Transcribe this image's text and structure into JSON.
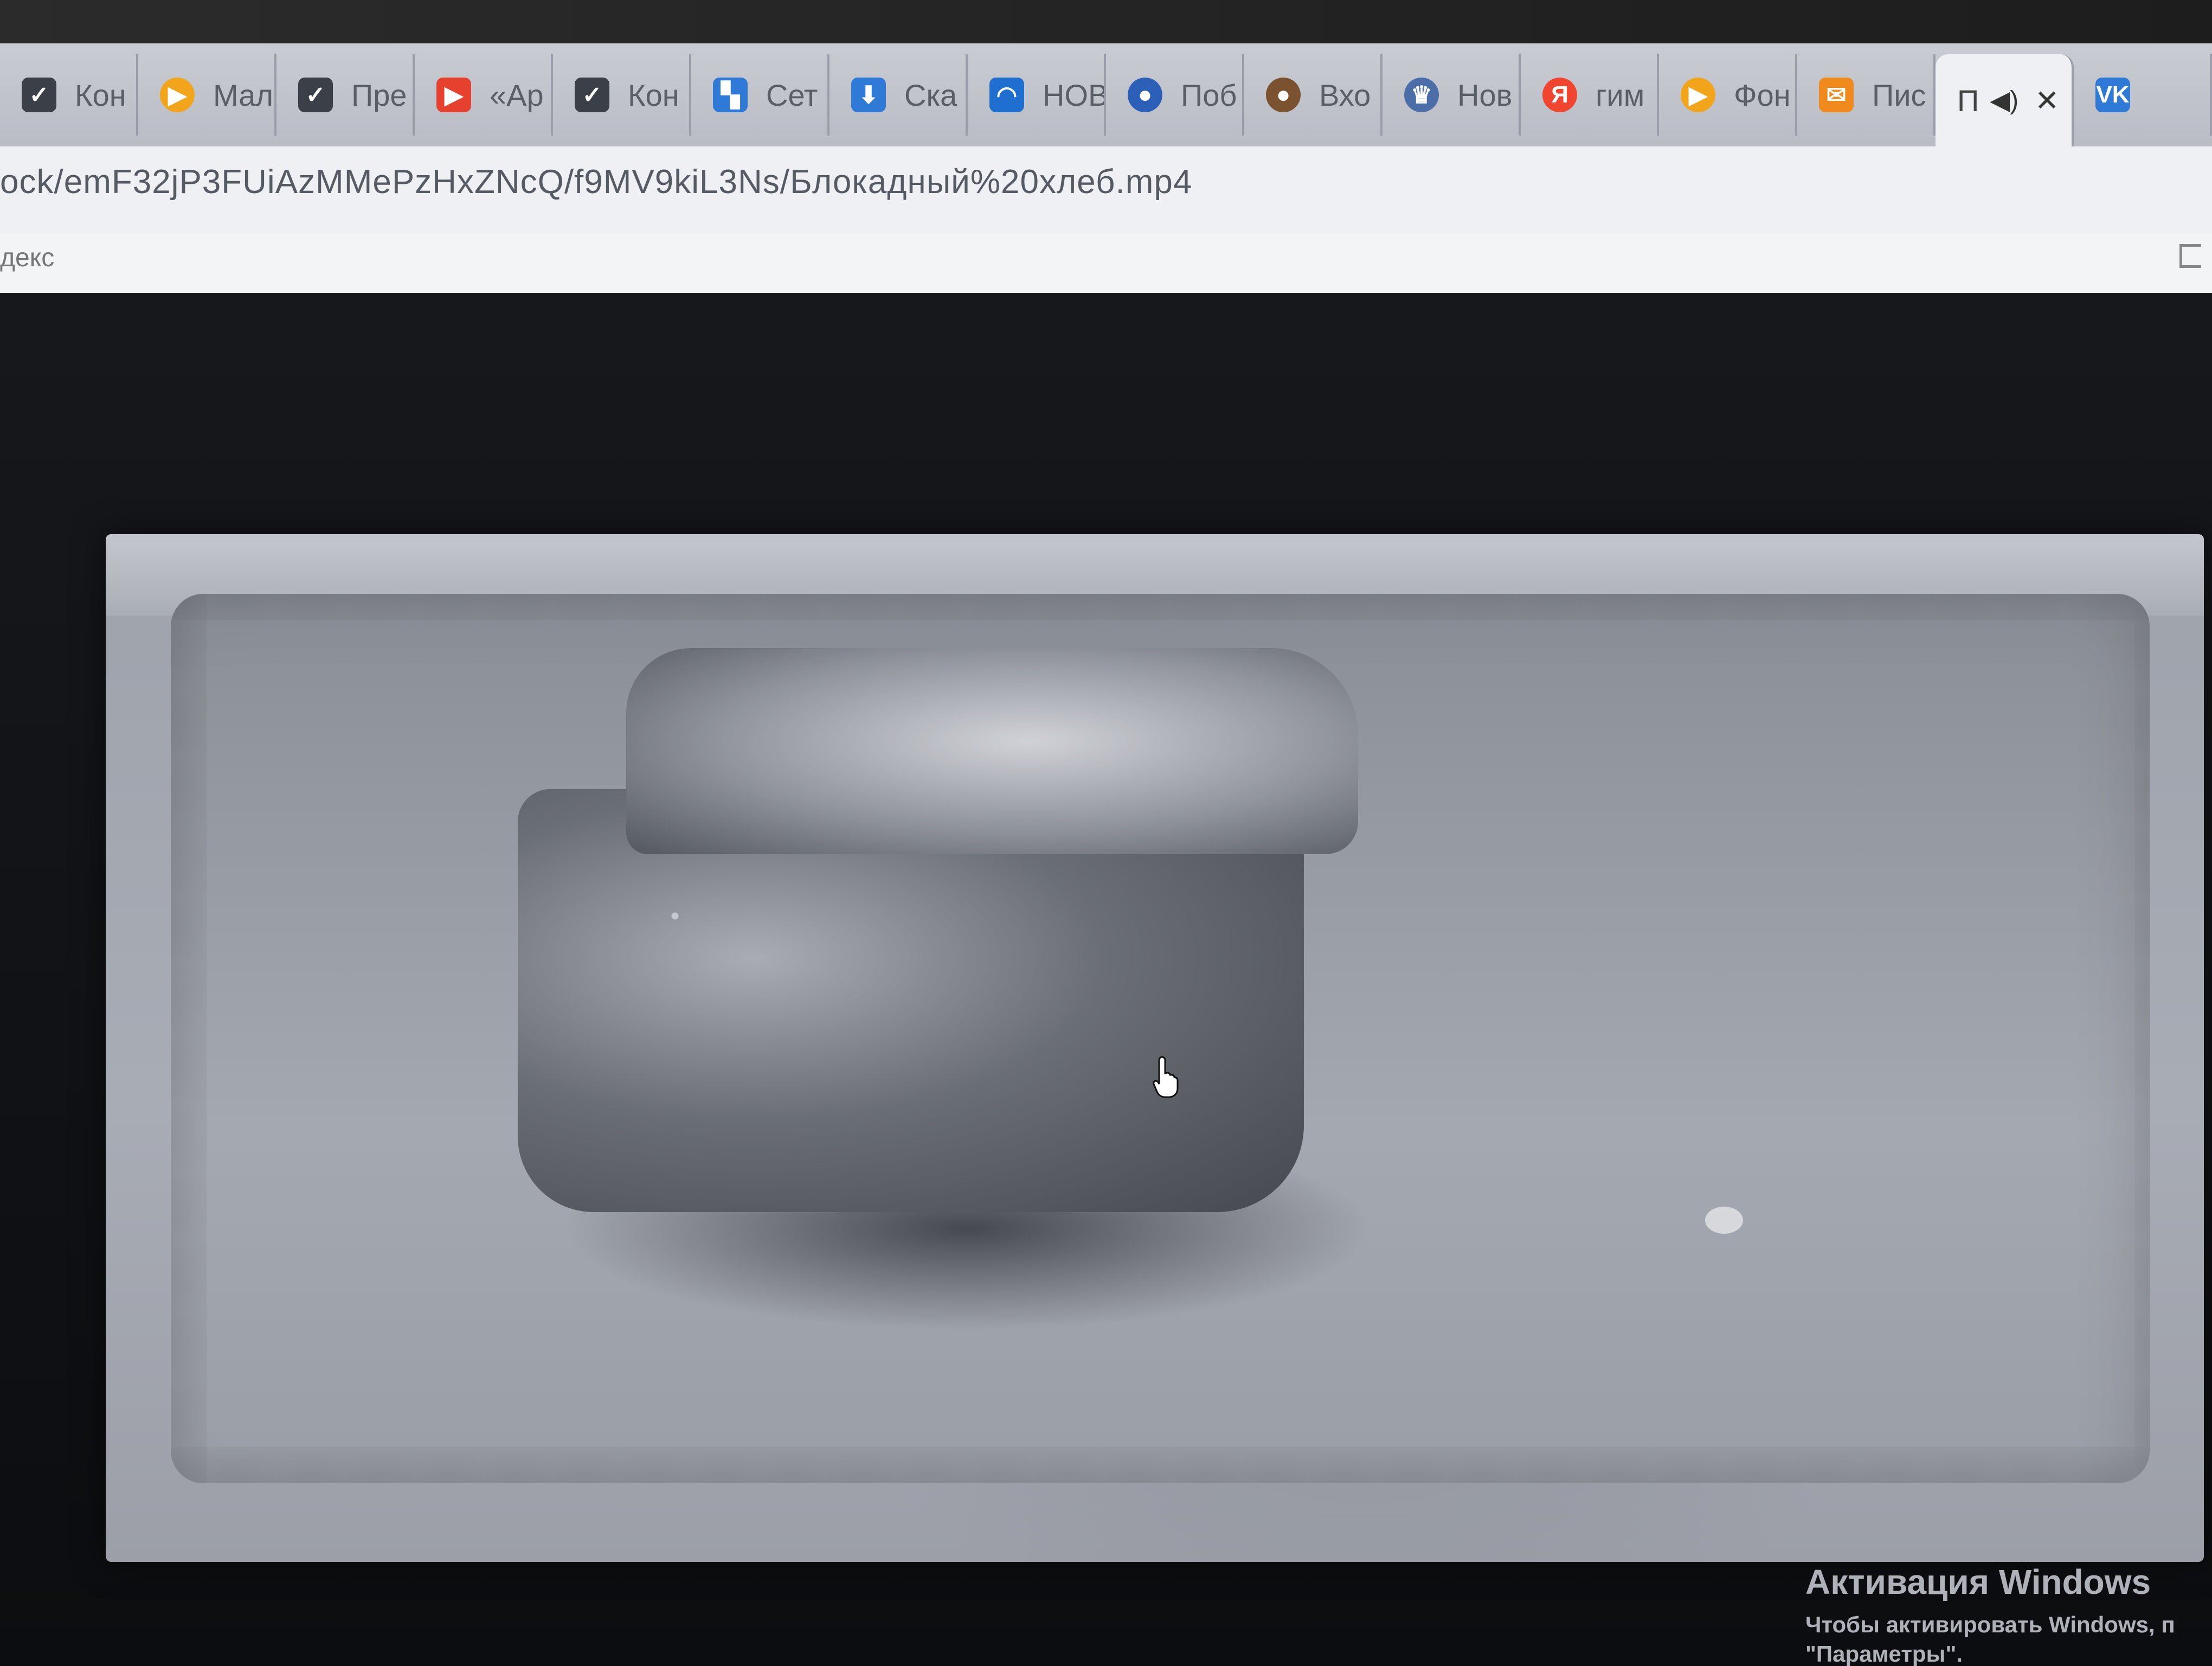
{
  "tabs": [
    {
      "label": "Кон",
      "icon": "check-icon",
      "color": "#3a3f48"
    },
    {
      "label": "Мал",
      "icon": "play-icon",
      "color": "#f2a51a"
    },
    {
      "label": "Пре",
      "icon": "check-icon",
      "color": "#3a3f48"
    },
    {
      "label": "«Ар",
      "icon": "youtube-icon",
      "color": "#e6402f"
    },
    {
      "label": "Кон",
      "icon": "check-icon",
      "color": "#3a3f48"
    },
    {
      "label": "Сет",
      "icon": "grid-icon",
      "color": "#2f7ad6"
    },
    {
      "label": "Ска",
      "icon": "download-icon",
      "color": "#2f7ad6"
    },
    {
      "label": "НОВ",
      "icon": "wave-icon",
      "color": "#1f6fd0"
    },
    {
      "label": "Поб",
      "icon": "globe-icon",
      "color": "#2c5fb8"
    },
    {
      "label": "Вхо",
      "icon": "dog-icon",
      "color": "#7a5230"
    },
    {
      "label": "Нов",
      "icon": "emblem-icon",
      "color": "#4c6ea8"
    },
    {
      "label": "гим",
      "icon": "yandex-icon",
      "color": "#f0452e",
      "glyph": "Я"
    },
    {
      "label": "Фон",
      "icon": "play-icon",
      "color": "#f2a51a"
    },
    {
      "label": "Пис",
      "icon": "mail-icon",
      "color": "#f08a1c"
    },
    {
      "label": "П",
      "icon": "none",
      "active": true
    },
    {
      "label": "",
      "icon": "vk-icon",
      "color": "#2f7ad6",
      "glyph": "VK"
    }
  ],
  "address": {
    "url": "ock/emF32jP3FUiAzMMePzHxZNcQ/f9MV9kiL3Ns/Блокадный%20хлеб.mp4"
  },
  "bookmarks": {
    "item": "декс"
  },
  "watermark": {
    "title": "Активация Windows",
    "line1": "Чтобы активировать Windows, п",
    "line2": "\"Параметры\"."
  }
}
